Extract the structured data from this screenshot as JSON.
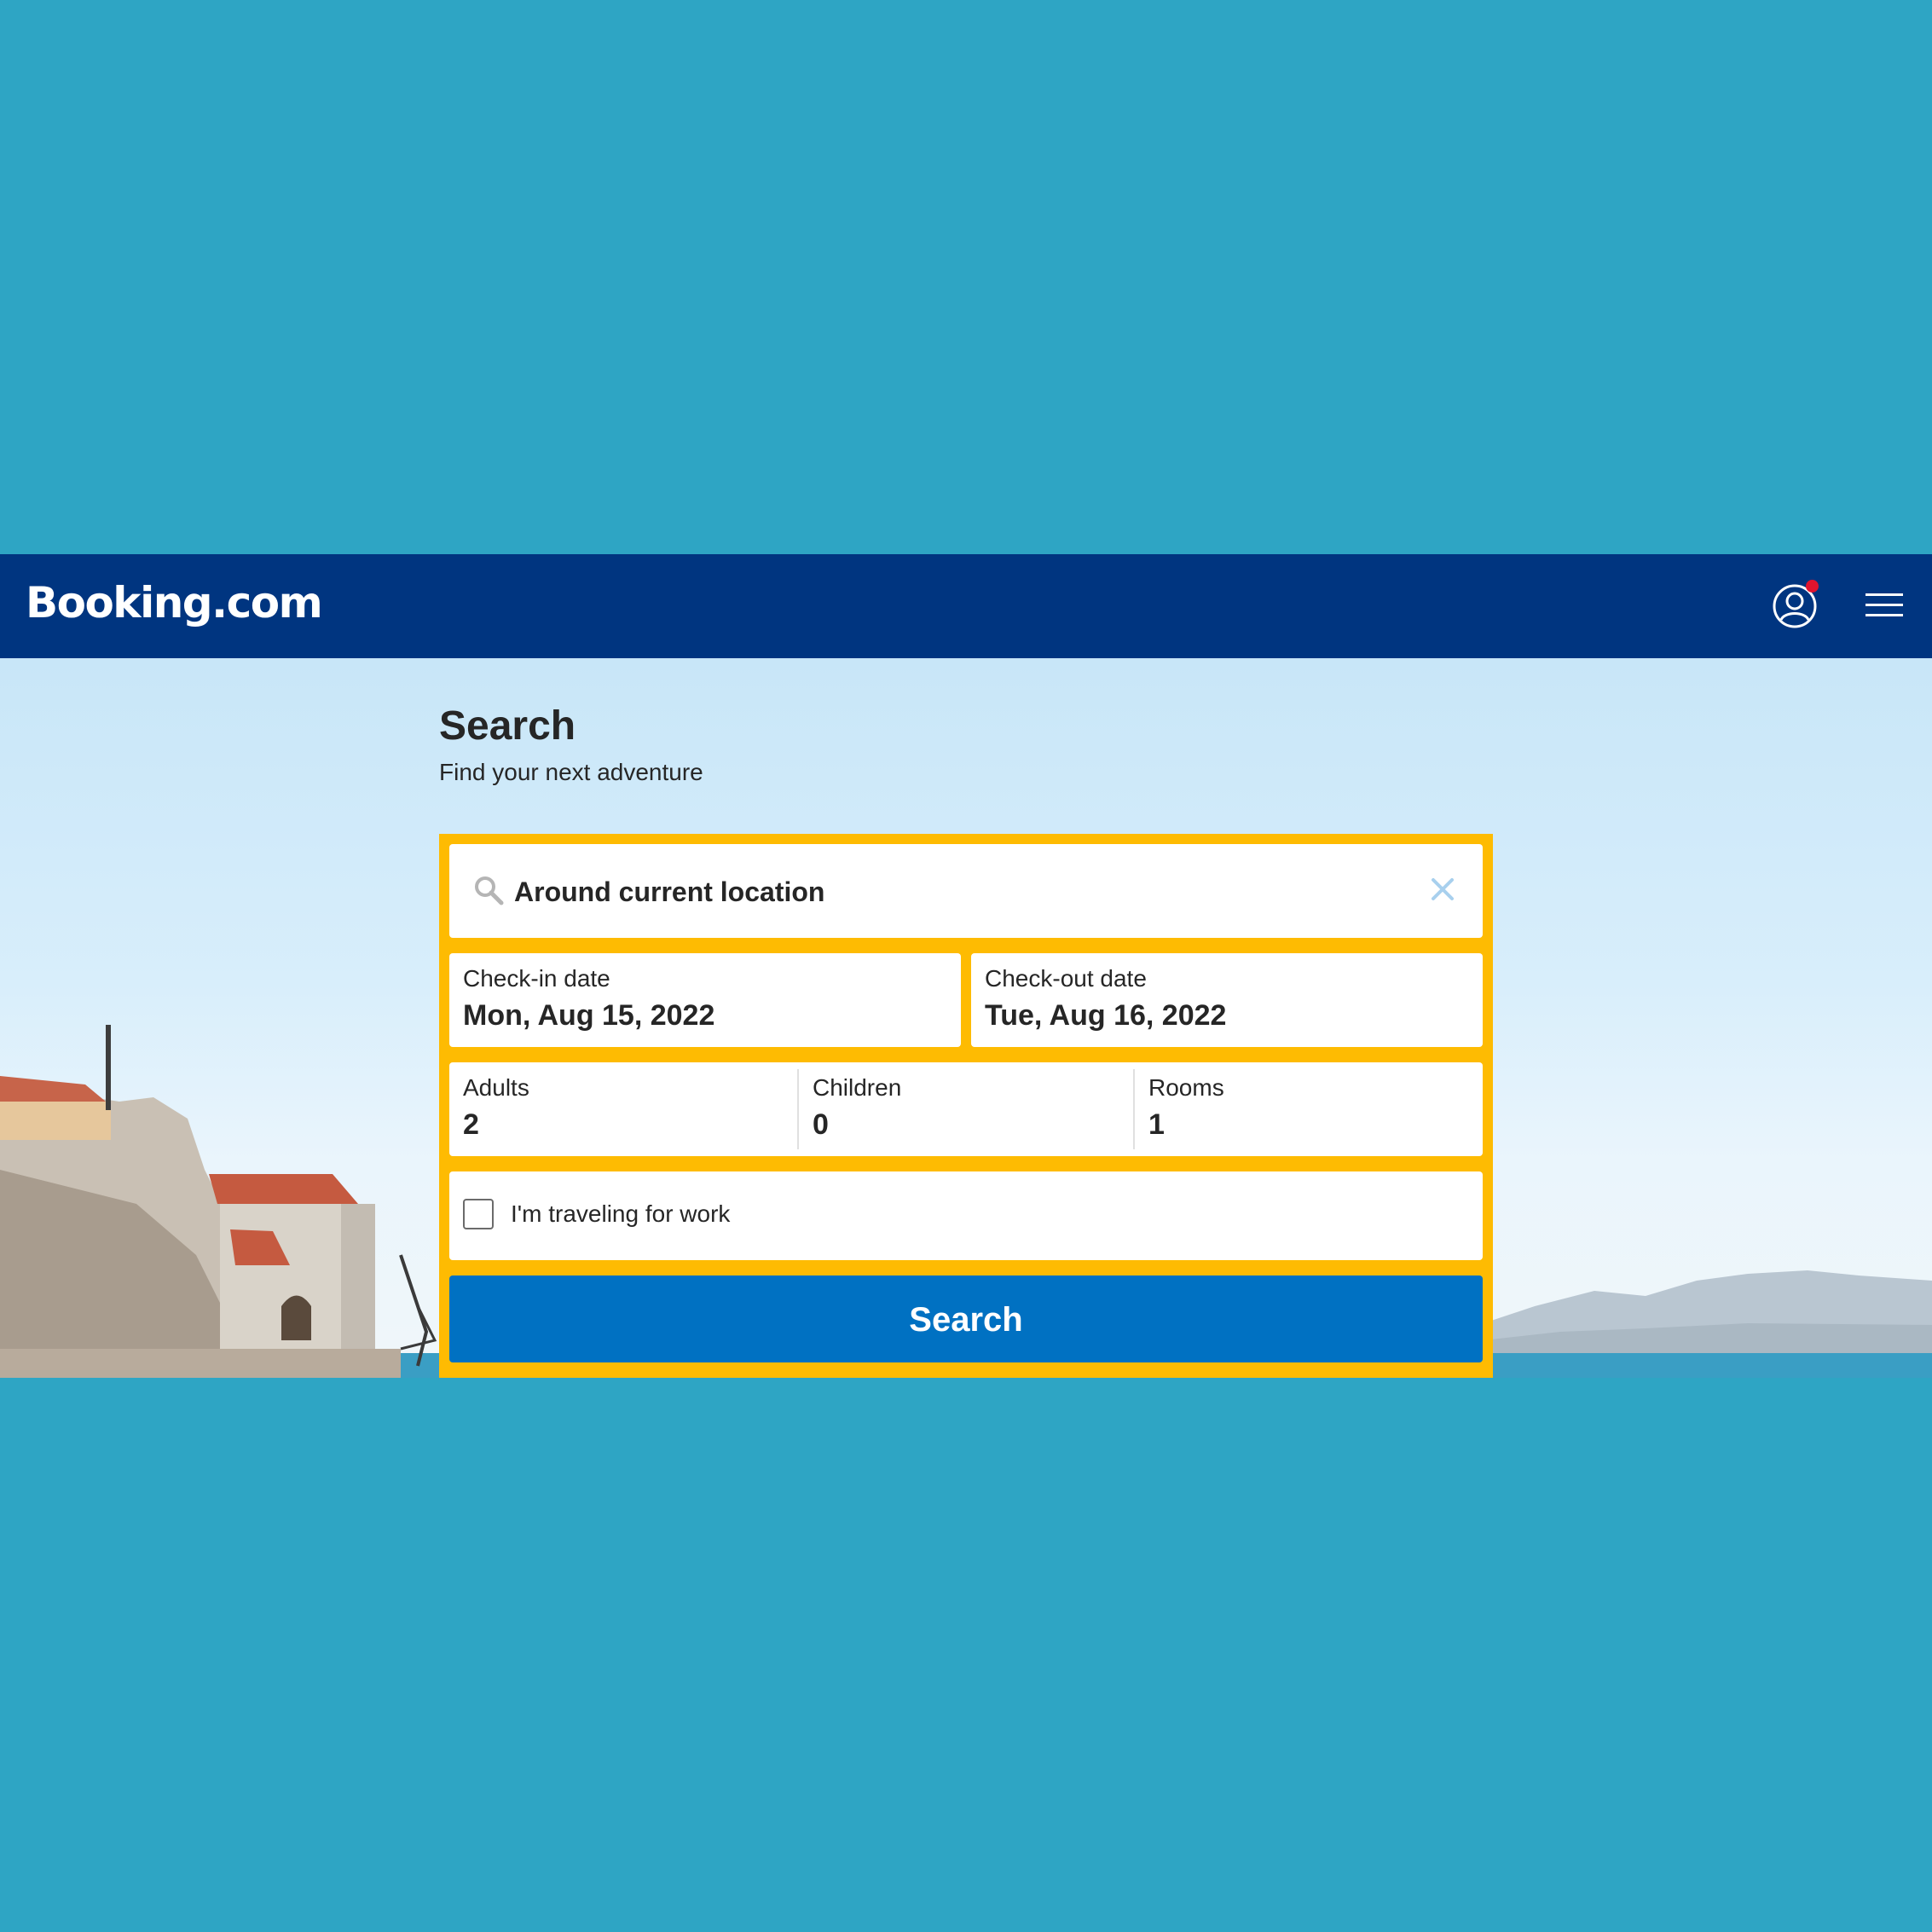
{
  "header": {
    "logo_text": "Booking.com",
    "account_icon": "user-circle-icon",
    "menu_icon": "hamburger-menu-icon",
    "brand_color": "#003580"
  },
  "main": {
    "title": "Search",
    "subtitle": "Find your next adventure"
  },
  "search": {
    "destination": {
      "icon": "search-icon",
      "value": "Around current location",
      "clear_icon": "close-icon"
    },
    "checkin": {
      "label": "Check-in date",
      "value": "Mon, Aug 15, 2022"
    },
    "checkout": {
      "label": "Check-out date",
      "value": "Tue, Aug 16, 2022"
    },
    "adults": {
      "label": "Adults",
      "value": "2"
    },
    "children": {
      "label": "Children",
      "value": "0"
    },
    "rooms": {
      "label": "Rooms",
      "value": "1"
    },
    "work_travel": {
      "label": "I'm traveling for work",
      "checked": false
    },
    "submit_label": "Search",
    "box_color": "#febb02",
    "button_color": "#0071c2"
  }
}
